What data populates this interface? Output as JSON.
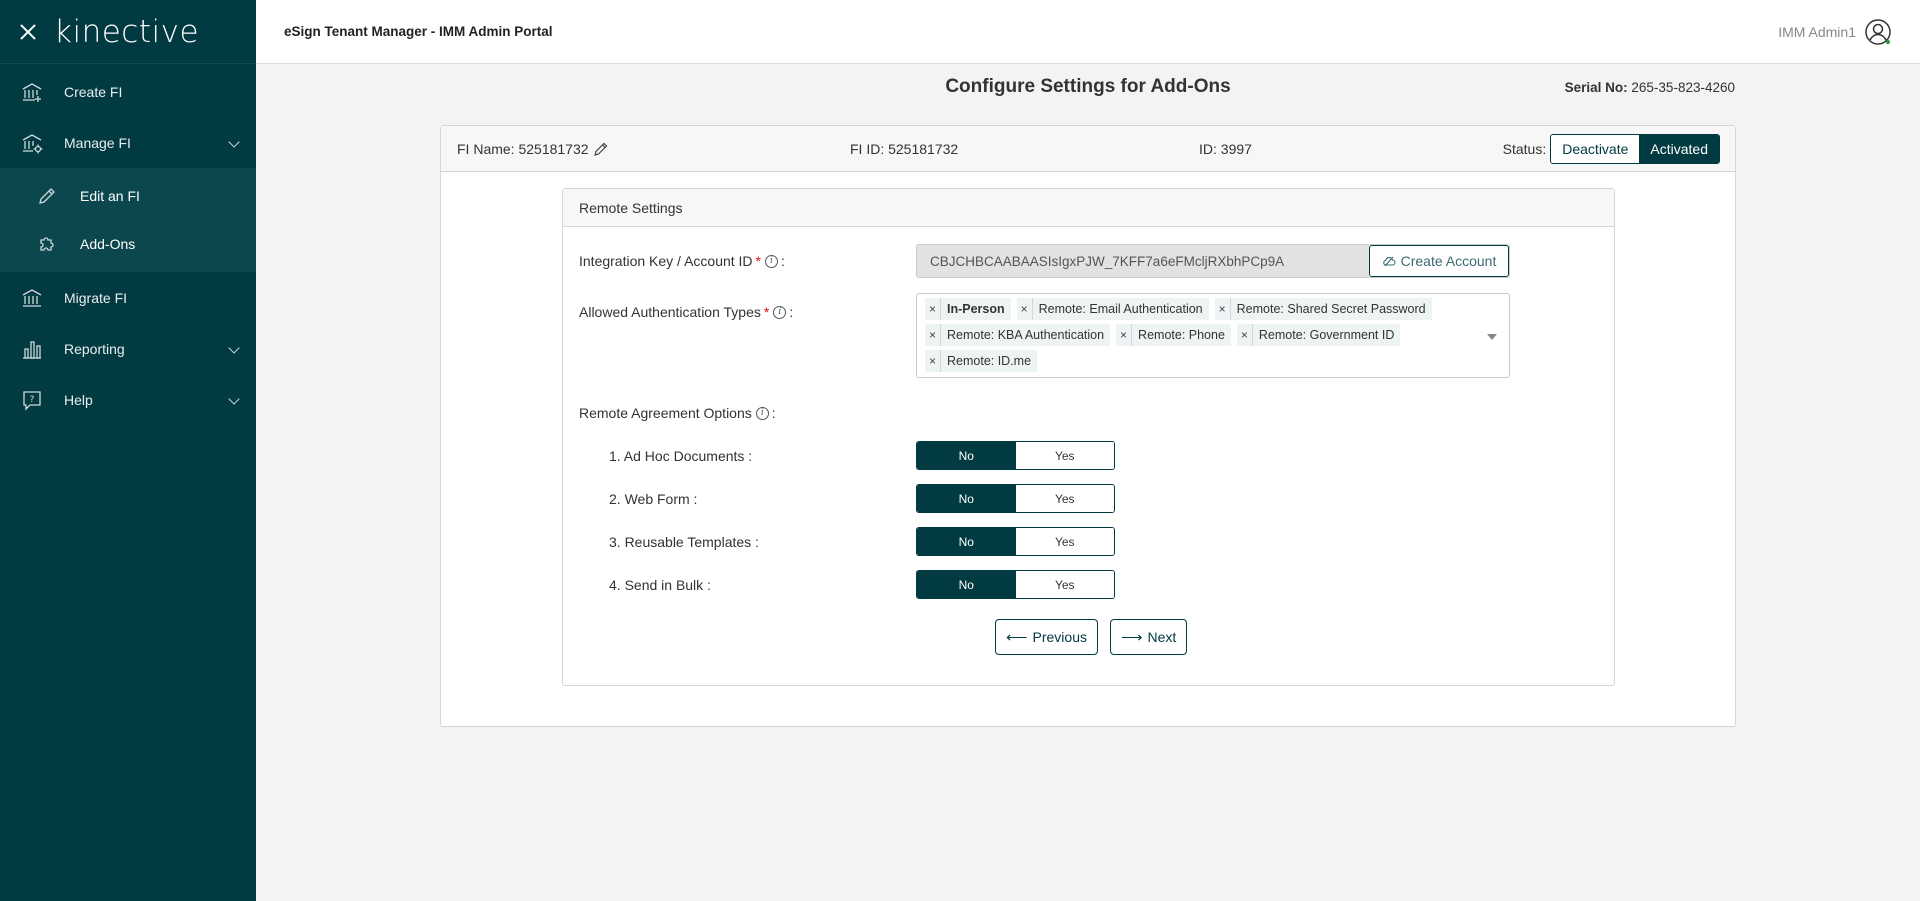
{
  "sidebar": {
    "logo": "kinective",
    "items": [
      {
        "label": "Create FI"
      },
      {
        "label": "Manage FI"
      },
      {
        "label": "Migrate FI"
      },
      {
        "label": "Reporting"
      },
      {
        "label": "Help"
      }
    ],
    "sub_items": [
      {
        "label": "Edit an FI"
      },
      {
        "label": "Add-Ons"
      }
    ]
  },
  "topbar": {
    "app_title": "eSign Tenant Manager - IMM Admin Portal",
    "user_name": "IMM Admin1"
  },
  "page": {
    "title": "Configure Settings for Add-Ons",
    "serial_label": "Serial No:",
    "serial_value": "265-35-823-4260"
  },
  "fi": {
    "name": "FI Name: 525181732",
    "fi_id": "FI ID: 525181732",
    "id": "ID: 3997",
    "status_label": "Status:",
    "deactivate": "Deactivate",
    "activated": "Activated"
  },
  "remote": {
    "title": "Remote Settings",
    "integration_label": "Integration Key / Account ID",
    "integration_value": "CBJCHBCAABAASIsIgxPJW_7KFF7a6eFMcljRXbhPCp9A",
    "create_account": "Create Account",
    "auth_label": "Allowed Authentication Types",
    "auth_tags": [
      "In-Person",
      "Remote: Email Authentication",
      "Remote: Shared Secret Password",
      "Remote: KBA Authentication",
      "Remote: Phone",
      "Remote: Government ID",
      "Remote: ID.me"
    ],
    "agreement_label": "Remote Agreement Options",
    "colon": ":",
    "options": [
      {
        "label": "1. Ad Hoc Documents :",
        "no": "No",
        "yes": "Yes"
      },
      {
        "label": "2. Web Form :",
        "no": "No",
        "yes": "Yes"
      },
      {
        "label": "3. Reusable Templates :",
        "no": "No",
        "yes": "Yes"
      },
      {
        "label": "4. Send in Bulk :",
        "no": "No",
        "yes": "Yes"
      }
    ],
    "previous": "Previous",
    "next": "Next"
  }
}
